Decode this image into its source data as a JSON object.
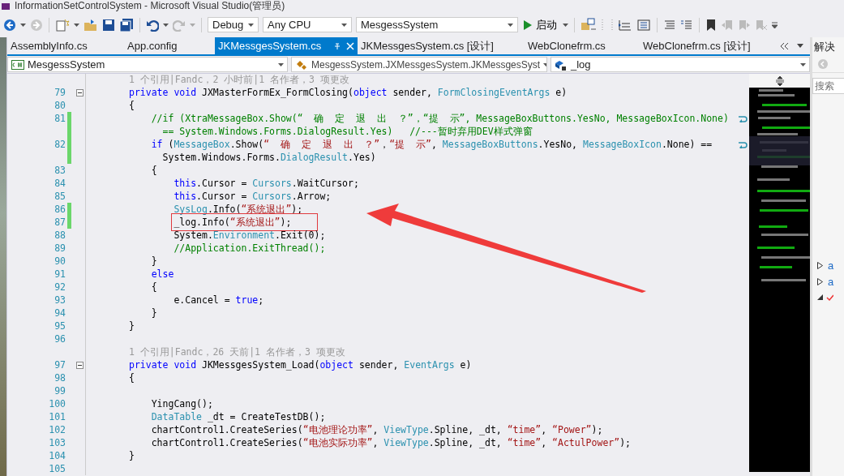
{
  "window": {
    "title": "InformationSetControlSystem - Microsoft Visual Studio(管理员)"
  },
  "toolbar": {
    "configuration": "Debug",
    "platform": "Any CPU",
    "startup_project": "MesgessSystem",
    "start_button": "启动"
  },
  "tabs": [
    {
      "label": "AssemblyInfo.cs",
      "selected": false
    },
    {
      "label": "App.config",
      "selected": false
    },
    {
      "label": "JKMessgesSystem.cs",
      "selected": true
    },
    {
      "label": "JKMessgesSystem.cs [设计]",
      "selected": false
    },
    {
      "label": "WebClonefrm.cs",
      "selected": false
    },
    {
      "label": "WebClonefrm.cs [设计]",
      "selected": false
    }
  ],
  "navigation_bar": {
    "project": "MesgessSystem",
    "type": "MesgessSystem.JXMessgesSystem.JKMessgesSyst",
    "member": "_log"
  },
  "code_rows": [
    {
      "kind": "lens",
      "changed": false,
      "text": "1 个引用|Fandc，2 小时前|1 名作者，3 项更改"
    },
    {
      "kind": "code",
      "number": "79",
      "changed": false,
      "collapsible": true,
      "indent": "",
      "tokens": [
        {
          "kind": "kw",
          "text": "private void"
        },
        {
          "kind": "plain",
          "text": " JXMasterFormEx_FormClosing("
        },
        {
          "kind": "kw",
          "text": "object"
        },
        {
          "kind": "plain",
          "text": " sender, "
        },
        {
          "kind": "type",
          "text": "FormClosingEventArgs"
        },
        {
          "kind": "plain",
          "text": " e)"
        }
      ]
    },
    {
      "kind": "code",
      "number": "80",
      "changed": false,
      "indent": "",
      "tokens": [
        {
          "kind": "plain",
          "text": "{"
        }
      ]
    },
    {
      "kind": "code",
      "number": "81",
      "changed": true,
      "wrapped": true,
      "indent": "    ",
      "tokens": [
        {
          "kind": "comment",
          "text": "//if (XtraMessageBox.Show(“  确  定  退  出  ？”，“提  示”, MessageBoxButtons.YesNo, MessageBoxIcon.None)"
        }
      ]
    },
    {
      "kind": "wrap",
      "changed": true,
      "indent": "      ",
      "tokens": [
        {
          "kind": "comment",
          "text": "== System.Windows.Forms.DialogResult.Yes)   //---暂时弃用DEV样式弹窗"
        }
      ]
    },
    {
      "kind": "code",
      "number": "82",
      "changed": true,
      "wrapped": true,
      "indent": "    ",
      "tokens": [
        {
          "kind": "kw",
          "text": "if"
        },
        {
          "kind": "plain",
          "text": " ("
        },
        {
          "kind": "type",
          "text": "MessageBox"
        },
        {
          "kind": "plain",
          "text": ".Show("
        },
        {
          "kind": "string",
          "text": "“  确  定  退  出  ？”"
        },
        {
          "kind": "plain",
          "text": "，"
        },
        {
          "kind": "string",
          "text": "“提  示”"
        },
        {
          "kind": "plain",
          "text": ", "
        },
        {
          "kind": "type",
          "text": "MessageBoxButtons"
        },
        {
          "kind": "plain",
          "text": ".YesNo, "
        },
        {
          "kind": "type",
          "text": "MessageBoxIcon"
        },
        {
          "kind": "plain",
          "text": ".None) =="
        }
      ]
    },
    {
      "kind": "wrap",
      "changed": true,
      "indent": "      ",
      "tokens": [
        {
          "kind": "plain",
          "text": "System.Windows.Forms."
        },
        {
          "kind": "type",
          "text": "DialogResult"
        },
        {
          "kind": "plain",
          "text": ".Yes)"
        }
      ]
    },
    {
      "kind": "code",
      "number": "83",
      "changed": false,
      "indent": "    ",
      "tokens": [
        {
          "kind": "plain",
          "text": "{"
        }
      ]
    },
    {
      "kind": "code",
      "number": "84",
      "changed": false,
      "indent": "        ",
      "tokens": [
        {
          "kind": "kw",
          "text": "this"
        },
        {
          "kind": "plain",
          "text": ".Cursor = "
        },
        {
          "kind": "type",
          "text": "Cursors"
        },
        {
          "kind": "plain",
          "text": ".WaitCursor;"
        }
      ]
    },
    {
      "kind": "code",
      "number": "85",
      "changed": false,
      "indent": "        ",
      "tokens": [
        {
          "kind": "kw",
          "text": "this"
        },
        {
          "kind": "plain",
          "text": ".Cursor = "
        },
        {
          "kind": "type",
          "text": "Cursors"
        },
        {
          "kind": "plain",
          "text": ".Arrow;"
        }
      ]
    },
    {
      "kind": "code",
      "number": "86",
      "changed": true,
      "indent": "        ",
      "tokens": [
        {
          "kind": "type",
          "text": "SysLog"
        },
        {
          "kind": "plain",
          "text": ".Info("
        },
        {
          "kind": "string",
          "text": "“系统退出”"
        },
        {
          "kind": "plain",
          "text": ");"
        }
      ]
    },
    {
      "kind": "code",
      "number": "87",
      "changed": true,
      "annotated": true,
      "indent": "        ",
      "tokens": [
        {
          "kind": "plain",
          "text": "_log.Info("
        },
        {
          "kind": "string",
          "text": "“系统退出”"
        },
        {
          "kind": "plain",
          "text": ");"
        }
      ]
    },
    {
      "kind": "code",
      "number": "88",
      "changed": false,
      "indent": "        ",
      "tokens": [
        {
          "kind": "plain",
          "text": "System."
        },
        {
          "kind": "type",
          "text": "Environment"
        },
        {
          "kind": "plain",
          "text": ".Exit(0);"
        }
      ]
    },
    {
      "kind": "code",
      "number": "89",
      "changed": false,
      "indent": "        ",
      "tokens": [
        {
          "kind": "comment",
          "text": "//Application.ExitThread();"
        }
      ]
    },
    {
      "kind": "code",
      "number": "90",
      "changed": false,
      "indent": "    ",
      "tokens": [
        {
          "kind": "plain",
          "text": "}"
        }
      ]
    },
    {
      "kind": "code",
      "number": "91",
      "changed": false,
      "indent": "    ",
      "tokens": [
        {
          "kind": "kw",
          "text": "else"
        }
      ]
    },
    {
      "kind": "code",
      "number": "92",
      "changed": false,
      "indent": "    ",
      "tokens": [
        {
          "kind": "plain",
          "text": "{"
        }
      ]
    },
    {
      "kind": "code",
      "number": "93",
      "changed": false,
      "indent": "        ",
      "tokens": [
        {
          "kind": "plain",
          "text": "e.Cancel = "
        },
        {
          "kind": "kw",
          "text": "true"
        },
        {
          "kind": "plain",
          "text": ";"
        }
      ]
    },
    {
      "kind": "code",
      "number": "94",
      "changed": false,
      "indent": "    ",
      "tokens": [
        {
          "kind": "plain",
          "text": "}"
        }
      ]
    },
    {
      "kind": "code",
      "number": "95",
      "changed": false,
      "indent": "",
      "tokens": [
        {
          "kind": "plain",
          "text": "}"
        }
      ]
    },
    {
      "kind": "code",
      "number": "96",
      "changed": false,
      "indent": "",
      "tokens": []
    },
    {
      "kind": "lens",
      "changed": false,
      "text": "1 个引用|Fandc，26 天前|1 名作者，3 项更改"
    },
    {
      "kind": "code",
      "number": "97",
      "changed": false,
      "collapsible": true,
      "indent": "",
      "tokens": [
        {
          "kind": "kw",
          "text": "private void"
        },
        {
          "kind": "plain",
          "text": " JKMessgesSystem_Load("
        },
        {
          "kind": "kw",
          "text": "object"
        },
        {
          "kind": "plain",
          "text": " sender, "
        },
        {
          "kind": "type",
          "text": "EventArgs"
        },
        {
          "kind": "plain",
          "text": " e)"
        }
      ]
    },
    {
      "kind": "code",
      "number": "98",
      "changed": false,
      "indent": "",
      "tokens": [
        {
          "kind": "plain",
          "text": "{"
        }
      ]
    },
    {
      "kind": "code",
      "number": "99",
      "changed": false,
      "indent": "",
      "tokens": []
    },
    {
      "kind": "code",
      "number": "100",
      "changed": false,
      "indent": "    ",
      "tokens": [
        {
          "kind": "plain",
          "text": "YingCang();"
        }
      ]
    },
    {
      "kind": "code",
      "number": "101",
      "changed": false,
      "indent": "    ",
      "tokens": [
        {
          "kind": "type",
          "text": "DataTable"
        },
        {
          "kind": "plain",
          "text": " _dt = CreateTestDB();"
        }
      ]
    },
    {
      "kind": "code",
      "number": "102",
      "changed": false,
      "indent": "    ",
      "tokens": [
        {
          "kind": "plain",
          "text": "chartControl1.CreateSeries("
        },
        {
          "kind": "string",
          "text": "“电池理论功率”"
        },
        {
          "kind": "plain",
          "text": ", "
        },
        {
          "kind": "type",
          "text": "ViewType"
        },
        {
          "kind": "plain",
          "text": ".Spline, _dt, "
        },
        {
          "kind": "string",
          "text": "“time”"
        },
        {
          "kind": "plain",
          "text": ", "
        },
        {
          "kind": "string",
          "text": "“Power”"
        },
        {
          "kind": "plain",
          "text": ");"
        }
      ]
    },
    {
      "kind": "code",
      "number": "103",
      "changed": false,
      "indent": "    ",
      "tokens": [
        {
          "kind": "plain",
          "text": "chartControl1.CreateSeries("
        },
        {
          "kind": "string",
          "text": "“电池实际功率”"
        },
        {
          "kind": "plain",
          "text": ", "
        },
        {
          "kind": "type",
          "text": "ViewType"
        },
        {
          "kind": "plain",
          "text": ".Spline, _dt, "
        },
        {
          "kind": "string",
          "text": "“time”"
        },
        {
          "kind": "plain",
          "text": ", "
        },
        {
          "kind": "string",
          "text": "“ActulPower”"
        },
        {
          "kind": "plain",
          "text": ");"
        }
      ]
    },
    {
      "kind": "code",
      "number": "104",
      "changed": false,
      "indent": "",
      "tokens": [
        {
          "kind": "plain",
          "text": "}"
        }
      ]
    },
    {
      "kind": "code",
      "number": "105",
      "changed": false,
      "indent": "",
      "tokens": []
    }
  ],
  "side_panel": {
    "title": "解决",
    "search": {
      "placeholder": "搜索"
    },
    "tree": [
      {
        "label": "a",
        "expanded": false
      },
      {
        "label": "a",
        "expanded": false
      }
    ]
  }
}
